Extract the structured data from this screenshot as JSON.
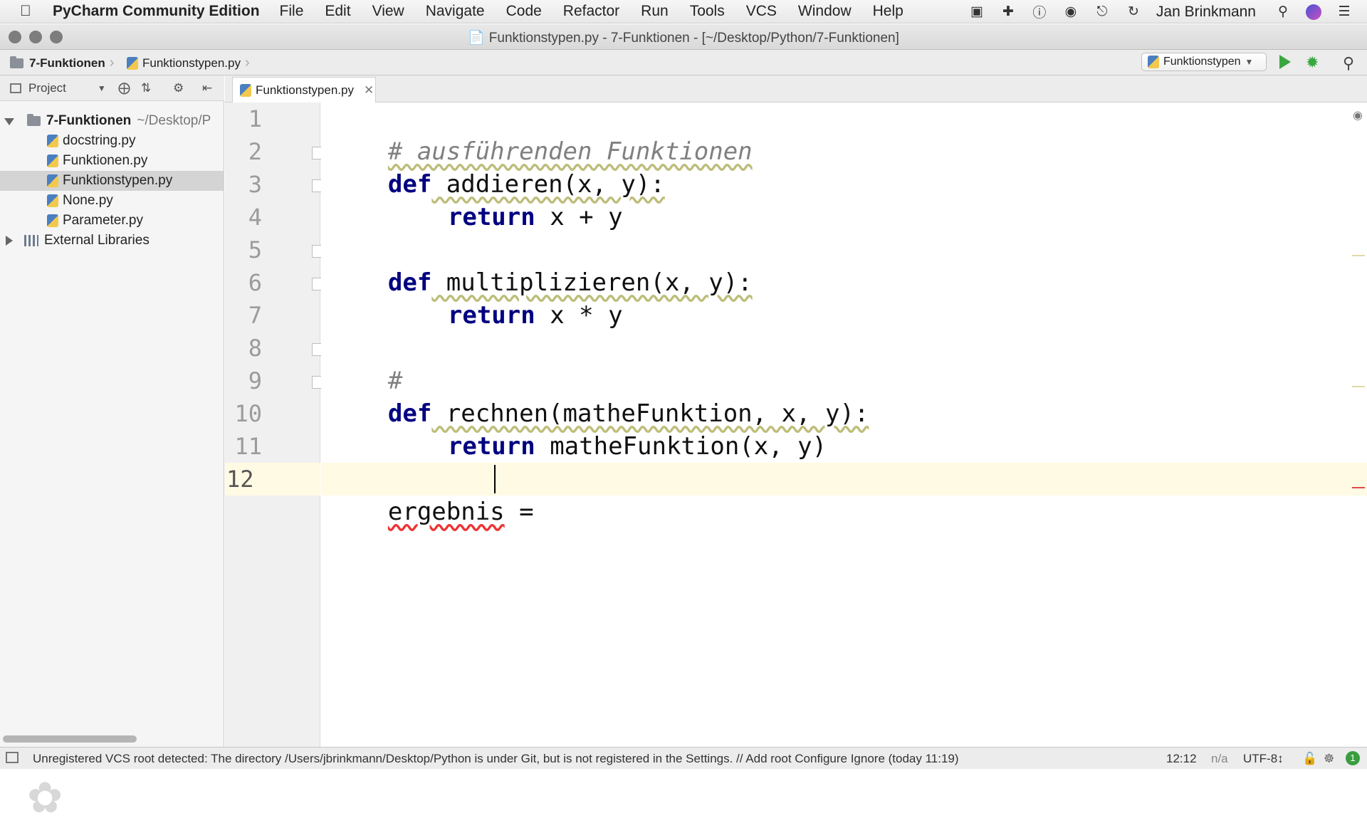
{
  "menubar": {
    "apple_icon": "apple-icon",
    "app_name": "PyCharm Community Edition",
    "items": [
      "File",
      "Edit",
      "View",
      "Navigate",
      "Code",
      "Refactor",
      "Run",
      "Tools",
      "VCS",
      "Window",
      "Help"
    ],
    "user": "Jan Brinkmann"
  },
  "window": {
    "title": "Funktionstypen.py - 7-Funktionen - [~/Desktop/Python/7-Funktionen]"
  },
  "navbar": {
    "crumb_project": "7-Funktionen",
    "crumb_file": "Funktionstypen.py",
    "run_config": "Funktionstypen"
  },
  "project_panel": {
    "title": "Project",
    "root": "7-Funktionen",
    "root_path": "~/Desktop/P",
    "files": [
      "docstring.py",
      "Funktionen.py",
      "Funktionstypen.py",
      "None.py",
      "Parameter.py"
    ],
    "selected_file": "Funktionstypen.py",
    "external": "External Libraries"
  },
  "editor": {
    "tab_label": "Funktionstypen.py",
    "line_numbers": [
      "1",
      "2",
      "3",
      "4",
      "5",
      "6",
      "7",
      "8",
      "9",
      "10",
      "11",
      "12"
    ],
    "current_line": 12,
    "code": {
      "l1": "# ausführenden Funktionen",
      "l2_kw": "def",
      "l2_rest": " addieren(x, y):",
      "l3_kw": "return",
      "l3_rest": " x + y",
      "l5_kw": "def",
      "l5_rest": " multiplizieren(x, y):",
      "l6_kw": "return",
      "l6_rest": " x * y",
      "l8": "#",
      "l9_kw": "def",
      "l9_rest": " rechnen(matheFunktion, x, y):",
      "l10_kw": "return",
      "l10_rest": " matheFunktion(x, y)",
      "l12_var": "ergebnis",
      "l12_rest": " = "
    }
  },
  "statusbar": {
    "message": "Unregistered VCS root detected: The directory /Users/jbrinkmann/Desktop/Python is under Git, but is not registered in the Settings. // Add root  Configure  Ignore (today 11:19)",
    "position": "12:12",
    "separator": "n/a",
    "encoding": "UTF-8↕",
    "badge": "1"
  },
  "colors": {
    "keyword": "#000080",
    "comment": "#808080",
    "current_line_bg": "#fffae3",
    "run_green": "#3aa640"
  }
}
